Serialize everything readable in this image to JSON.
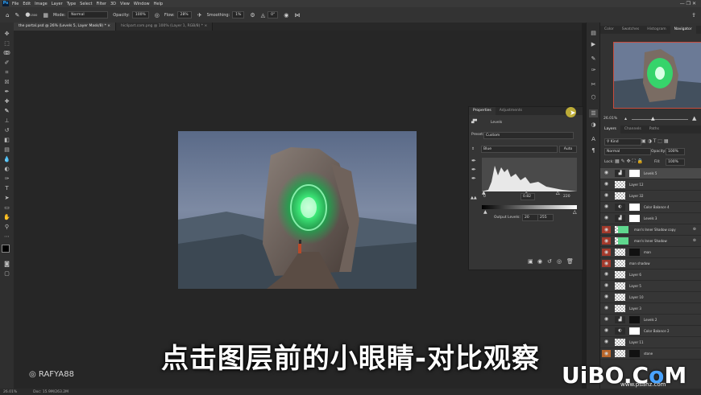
{
  "menubar": {
    "app_icon": "Ps",
    "items": [
      "File",
      "Edit",
      "Image",
      "Layer",
      "Type",
      "Select",
      "Filter",
      "3D",
      "View",
      "Window",
      "Help"
    ]
  },
  "options": {
    "mode_label": "Mode:",
    "mode_value": "Normal",
    "opacity_label": "Opacity:",
    "opacity_value": "100%",
    "flow_label": "Flow:",
    "flow_value": "28%",
    "smoothing_label": "Smoothing:",
    "smoothing_value": "1%",
    "angle_value": "0°",
    "brush_size": "1500"
  },
  "tabs": [
    {
      "label": "the portal.psd @ 26% (Levels 5, Layer Mask/8) *",
      "close": "×"
    },
    {
      "label": "hiclipart.com.png @ 100% (Layer 1, RGB/8) *",
      "close": "×"
    }
  ],
  "status": {
    "zoom": "26.01%",
    "doc": "Doc: 15.9M/263.2M"
  },
  "top_panel": {
    "tabs": [
      "Color",
      "Swatches",
      "Histogram",
      "Navigator"
    ],
    "active_tab": "Navigator",
    "zoom": "26.01%"
  },
  "layers_panel": {
    "tabs": [
      "Layers",
      "Channels",
      "Paths"
    ],
    "kind_label": "Kind",
    "blend_mode": "Normal",
    "opacity_label": "Opacity:",
    "opacity_value": "100%",
    "lock_label": "Lock:",
    "fill_label": "Fill:",
    "fill_value": "100%",
    "layers": [
      {
        "name": "Levels 5"
      },
      {
        "name": "Layer 12"
      },
      {
        "name": "Layer 32"
      },
      {
        "name": "Color Balance 4"
      },
      {
        "name": "Levels 3"
      },
      {
        "name": "man's Inner Shadow copy"
      },
      {
        "name": "man's Inner Shadow"
      },
      {
        "name": "man"
      },
      {
        "name": "man shadow"
      },
      {
        "name": "Layer 6"
      },
      {
        "name": "Layer 5"
      },
      {
        "name": "Layer 10"
      },
      {
        "name": "Layer 3"
      },
      {
        "name": "Levels 2"
      },
      {
        "name": "Color Balance 2"
      },
      {
        "name": "Layer 11"
      },
      {
        "name": "stone"
      }
    ]
  },
  "properties": {
    "tabs": [
      "Properties",
      "Adjustments"
    ],
    "type_label": "Levels",
    "preset_label": "Preset:",
    "preset_value": "Custom",
    "channel_value": "Blue",
    "auto_label": "Auto",
    "input_values": [
      "0",
      "0.82",
      "220"
    ],
    "output_label": "Output Levels:",
    "output_values": [
      "20",
      "255"
    ]
  },
  "overlay": {
    "subtitle": "点击图层前的小眼睛-对比观察",
    "watermark": "RAFYA88",
    "logo_pre": "UiBO",
    "logo_dot": ".",
    "logo_co": "C",
    "logo_o": "o",
    "logo_m": "M",
    "logo_sub": "www.psahz.com"
  },
  "colors": {
    "accent": "#31a8ff",
    "selection_red": "#a33a2c",
    "portal_green": "#2fe06b"
  }
}
